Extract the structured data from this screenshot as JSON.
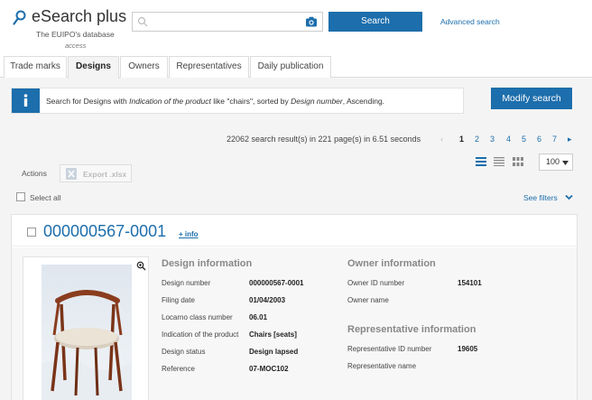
{
  "header": {
    "app_title": "eSearch plus",
    "subtitle_line1": "The EUIPO's database",
    "subtitle_line2": "access",
    "search_placeholder": "",
    "search_button": "Search",
    "advanced_search": "Advanced search"
  },
  "tabs": [
    {
      "label": "Trade marks"
    },
    {
      "label": "Designs"
    },
    {
      "label": "Owners"
    },
    {
      "label": "Representatives"
    },
    {
      "label": "Daily publication"
    }
  ],
  "banner": {
    "text_prefix": "Search for Designs with ",
    "field": "Indication of the product",
    "text_mid": " like \"chairs\", sorted by ",
    "sort_field": "Design number",
    "text_suffix": ", Ascending.",
    "modify_button": "Modify search"
  },
  "results": {
    "summary": "22062 search result(s) in 221 page(s) in 6.51 seconds",
    "pages": [
      "1",
      "2",
      "3",
      "4",
      "5",
      "6",
      "7"
    ],
    "current_page": "1",
    "per_page": "100"
  },
  "actions": {
    "label": "Actions",
    "export_label": "Export .xlsx",
    "select_all": "Select all",
    "see_filters": "See filters"
  },
  "result": {
    "title": "000000567-0001",
    "more_info": "+ info",
    "design_section": "Design information",
    "design_fields": [
      {
        "label": "Design number",
        "value": "000000567-0001"
      },
      {
        "label": "Filing date",
        "value": "01/04/2003"
      },
      {
        "label": "Locarno class number",
        "value": "06.01"
      },
      {
        "label": "Indication of the product",
        "value": "Chairs [seats]"
      },
      {
        "label": "Design status",
        "value": "Design lapsed"
      },
      {
        "label": "Reference",
        "value": "07-MOC102"
      }
    ],
    "owner_section": "Owner information",
    "owner_fields": [
      {
        "label": "Owner ID number",
        "value": "154101"
      },
      {
        "label": "Owner name",
        "value": ""
      }
    ],
    "rep_section": "Representative information",
    "rep_fields": [
      {
        "label": "Representative ID number",
        "value": "19605"
      },
      {
        "label": "Representative name",
        "value": ""
      }
    ]
  },
  "colors": {
    "brand_blue": "#1c6eac",
    "page_bg": "#f4f4f4"
  }
}
